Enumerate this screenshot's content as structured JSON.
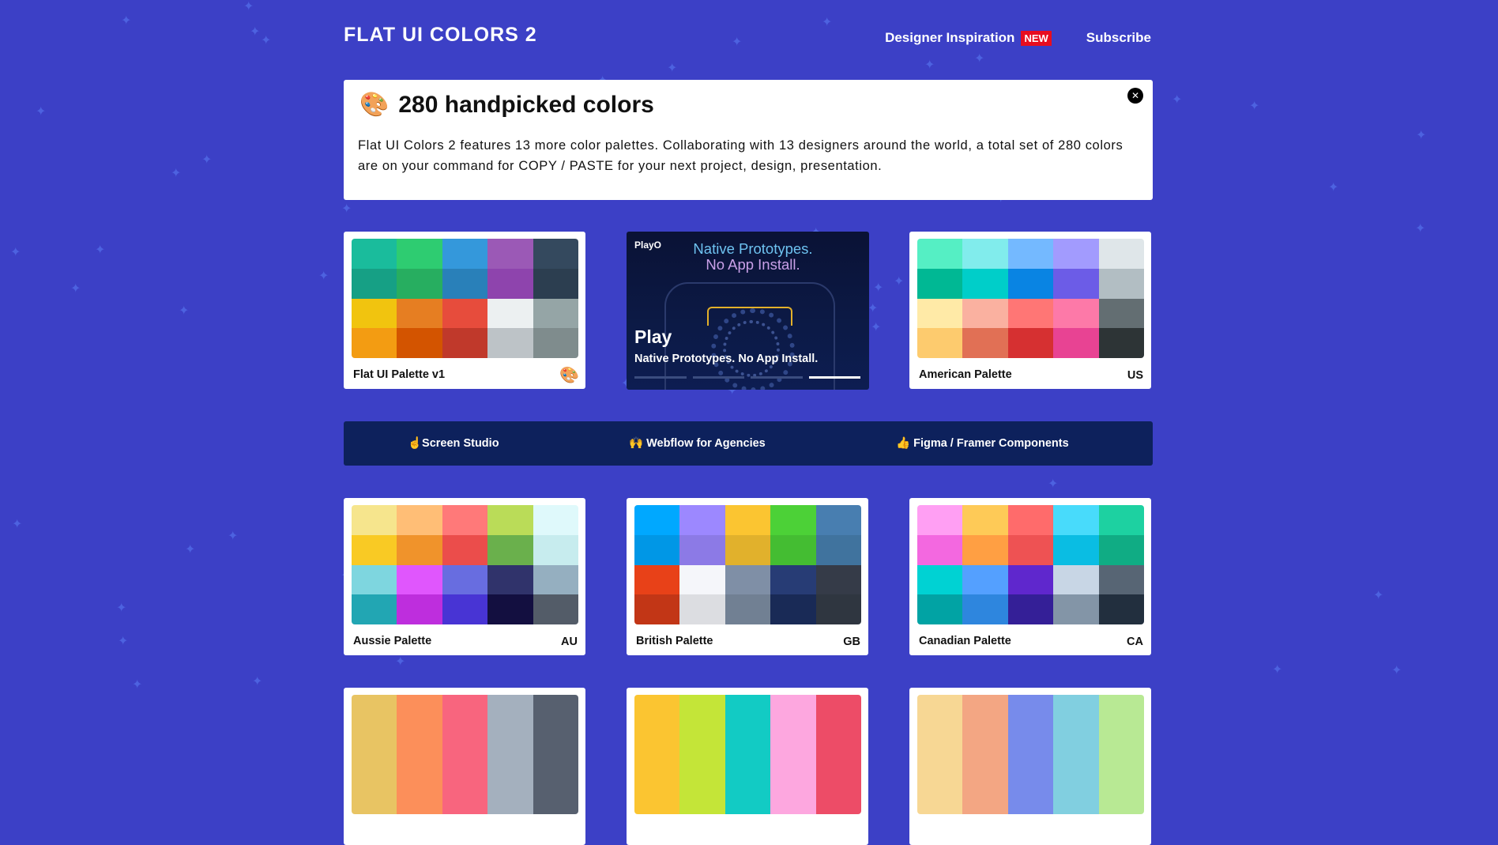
{
  "header": {
    "logo": "FLAT UI COLORS 2",
    "nav": {
      "inspiration": "Designer Inspiration",
      "badge": "NEW",
      "subscribe": "Subscribe"
    }
  },
  "banner": {
    "icon": "palette-icon",
    "title": "280 handpicked colors",
    "text": "Flat UI Colors 2 features 13 more color palettes. Collaborating with 13 designers around the world, a total set of 280 colors are on your command for COPY / PASTE for your next project, design, presentation.",
    "close_icon": "close-icon"
  },
  "ad": {
    "brand": "PlayO",
    "headline_line1": "Native Prototypes.",
    "headline_line2": "No App Install.",
    "title": "Play",
    "subtitle": "Native Prototypes. No App Install.",
    "progress_active_step": 4,
    "progress_total_steps": 4
  },
  "links": {
    "screen_studio": "☝️Screen Studio",
    "webflow": "🙌 Webflow for Agencies",
    "figma": "👍 Figma / Framer Components"
  },
  "palettes": [
    {
      "name": "Flat UI Palette v1",
      "code": "",
      "badge_icon": "palette-icon",
      "colors": [
        "#1abc9c",
        "#2ecc71",
        "#3498db",
        "#9b59b6",
        "#34495e",
        "#16a085",
        "#27ae60",
        "#2980b9",
        "#8e44ad",
        "#2c3e50",
        "#f1c40f",
        "#e67e22",
        "#e74c3c",
        "#ecf0f1",
        "#95a5a6",
        "#f39c12",
        "#d35400",
        "#c0392b",
        "#bdc3c7",
        "#7f8c8d"
      ]
    },
    {
      "name": "American Palette",
      "code": "US",
      "colors": [
        "#55efc4",
        "#81ecec",
        "#74b9ff",
        "#a29bfe",
        "#dfe6e9",
        "#00b894",
        "#00cec9",
        "#0984e3",
        "#6c5ce7",
        "#b2bec3",
        "#ffeaa7",
        "#fab1a0",
        "#ff7675",
        "#fd79a8",
        "#636e72",
        "#fdcb6e",
        "#e17055",
        "#d63031",
        "#e84393",
        "#2d3436"
      ]
    },
    {
      "name": "Aussie Palette",
      "code": "AU",
      "colors": [
        "#f6e58d",
        "#ffbe76",
        "#ff7979",
        "#badc58",
        "#dff9fb",
        "#f9ca24",
        "#f0932b",
        "#eb4d4b",
        "#6ab04c",
        "#c7ecee",
        "#7ed6df",
        "#e056fd",
        "#686de0",
        "#30336b",
        "#95afc0",
        "#22a6b3",
        "#be2edd",
        "#4834d4",
        "#130f40",
        "#535c68"
      ]
    },
    {
      "name": "British Palette",
      "code": "GB",
      "colors": [
        "#00a8ff",
        "#9c88ff",
        "#fbc531",
        "#4cd137",
        "#487eb0",
        "#0097e6",
        "#8c7ae6",
        "#e1b12c",
        "#44bd32",
        "#40739e",
        "#e84118",
        "#f5f6fa",
        "#7f8fa6",
        "#273c75",
        "#353b48",
        "#c23616",
        "#dcdde1",
        "#718093",
        "#192a56",
        "#2f3640"
      ]
    },
    {
      "name": "Canadian Palette",
      "code": "CA",
      "colors": [
        "#ff9ff3",
        "#feca57",
        "#ff6b6b",
        "#48dbfb",
        "#1dd1a1",
        "#f368e0",
        "#ff9f43",
        "#ee5253",
        "#0abde3",
        "#10ac84",
        "#00d2d3",
        "#54a0ff",
        "#5f27cd",
        "#c8d6e5",
        "#576574",
        "#01a3a4",
        "#2e86de",
        "#341f97",
        "#8395a7",
        "#222f3e"
      ]
    },
    {
      "name": "",
      "code": "",
      "colors": [
        "#e8c463",
        "#fc8f5a",
        "#f8657e",
        "#a4b0be",
        "#57606f",
        "#e8c463",
        "#fc8f5a",
        "#f8657e",
        "#a4b0be",
        "#57606f",
        "#e8c463",
        "#fc8f5a",
        "#f8657e",
        "#a4b0be",
        "#57606f",
        "#e8c463",
        "#fc8f5a",
        "#f8657e",
        "#a4b0be",
        "#57606f"
      ]
    },
    {
      "name": "",
      "code": "",
      "colors": [
        "#fbc531",
        "#c4e538",
        "#12cbc4",
        "#fda7df",
        "#ed4c67",
        "#fbc531",
        "#c4e538",
        "#12cbc4",
        "#fda7df",
        "#ed4c67",
        "#fbc531",
        "#c4e538",
        "#12cbc4",
        "#fda7df",
        "#ed4c67",
        "#fbc531",
        "#c4e538",
        "#12cbc4",
        "#fda7df",
        "#ed4c67"
      ]
    },
    {
      "name": "",
      "code": "",
      "colors": [
        "#f7d794",
        "#f3a683",
        "#778beb",
        "#81cfe0",
        "#b8e994",
        "#f7d794",
        "#f3a683",
        "#778beb",
        "#81cfe0",
        "#b8e994",
        "#f7d794",
        "#f3a683",
        "#778beb",
        "#81cfe0",
        "#b8e994",
        "#f7d794",
        "#f3a683",
        "#778beb",
        "#81cfe0",
        "#b8e994"
      ]
    }
  ]
}
